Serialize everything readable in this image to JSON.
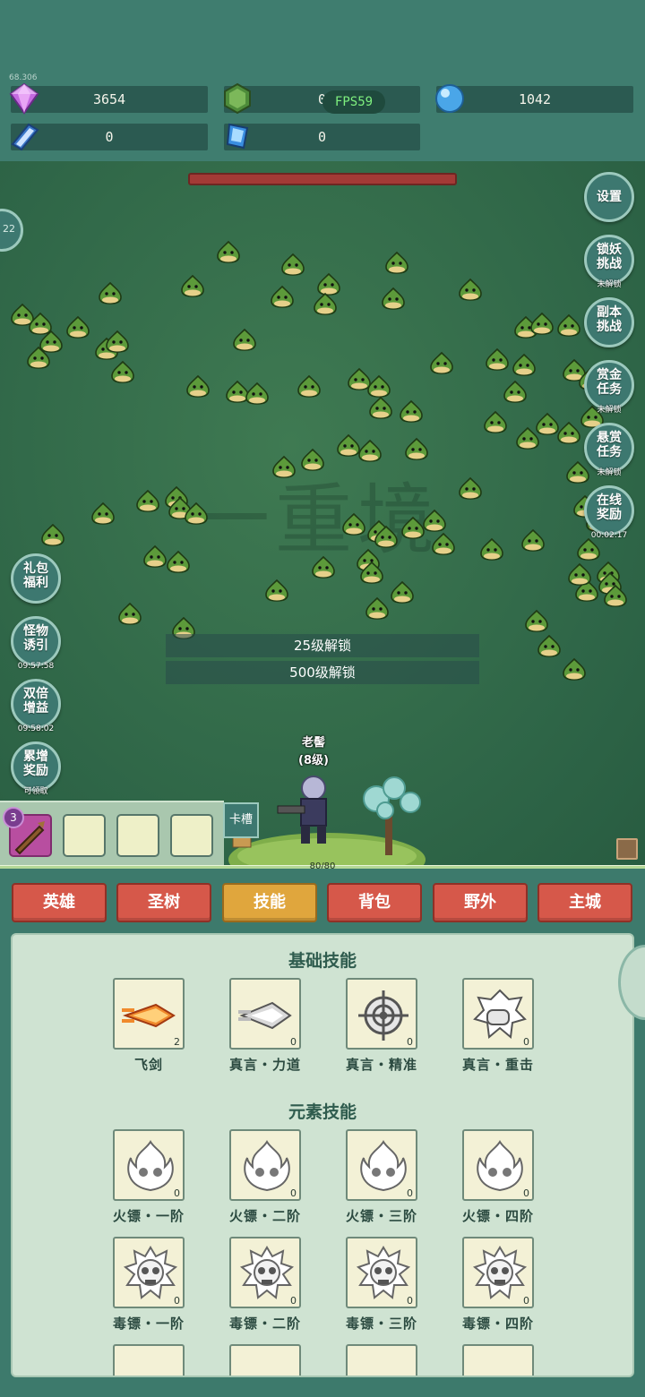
{
  "resources": {
    "gem": "3654",
    "shield": "0",
    "orb": "1042",
    "book": "0",
    "crystal": "0"
  },
  "hud": {
    "fps": "FPS59",
    "tiny_text": "68.306"
  },
  "battle": {
    "watermark": "一重境",
    "boss_hp_fraction": 1.0,
    "unlock_25": "25级解锁",
    "unlock_500": "500级解锁",
    "hero_name": "老髻",
    "hero_level": "(8级)",
    "hp_text": "80/80",
    "slot_level": "3",
    "kacao": "卡槽"
  },
  "left_buttons": [
    {
      "line1": "礼包",
      "line2": "福利",
      "sub": ""
    },
    {
      "line1": "怪物",
      "line2": "诱引",
      "sub": "09:57:58"
    },
    {
      "line1": "双倍",
      "line2": "增益",
      "sub": "09:58:02"
    },
    {
      "line1": "累增",
      "line2": "奖励",
      "sub": "可领取"
    }
  ],
  "right_buttons": [
    {
      "line1": "设置",
      "line2": "",
      "sub": ""
    },
    {
      "line1": "锁妖",
      "line2": "挑战",
      "sub": "未解锁"
    },
    {
      "line1": "副本",
      "line2": "挑战",
      "sub": ""
    },
    {
      "line1": "赏金",
      "line2": "任务",
      "sub": "未解锁"
    },
    {
      "line1": "悬赏",
      "line2": "任务",
      "sub": "未解锁"
    },
    {
      "line1": "在线",
      "line2": "奖励",
      "sub": "00:02:17"
    }
  ],
  "tabs": [
    "英雄",
    "圣树",
    "技能",
    "背包",
    "野外",
    "主城"
  ],
  "active_tab": "技能",
  "skills": {
    "basic_title": "基础技能",
    "basic": [
      {
        "name": "飞剑",
        "count": "2",
        "icon": "flying-sword-icon"
      },
      {
        "name": "真言・力道",
        "count": "0",
        "icon": "arrow-power-icon"
      },
      {
        "name": "真言・精准",
        "count": "0",
        "icon": "crosshair-icon"
      },
      {
        "name": "真言・重击",
        "count": "0",
        "icon": "fist-icon"
      }
    ],
    "element_title": "元素技能",
    "fire": [
      {
        "name": "火镖・一阶",
        "count": "0"
      },
      {
        "name": "火镖・二阶",
        "count": "0"
      },
      {
        "name": "火镖・三阶",
        "count": "0"
      },
      {
        "name": "火镖・四阶",
        "count": "0"
      }
    ],
    "poison": [
      {
        "name": "毒镖・一阶",
        "count": "0"
      },
      {
        "name": "毒镖・二阶",
        "count": "0"
      },
      {
        "name": "毒镖・三阶",
        "count": "0"
      },
      {
        "name": "毒镖・四阶",
        "count": "0"
      }
    ]
  },
  "colors": {
    "tab": "#d6584a",
    "tab_active": "#e0a63d",
    "background": "#3d7a6c"
  }
}
